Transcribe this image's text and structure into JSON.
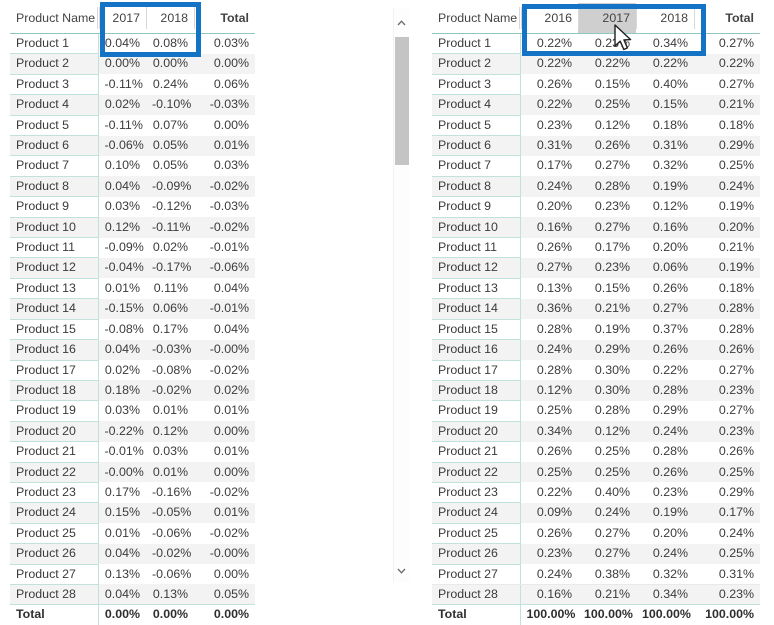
{
  "left_matrix": {
    "name": "percent-difference-matrix",
    "headers": [
      "Product Name",
      "2017",
      "2018",
      "Total"
    ],
    "rows": [
      {
        "label": "Product 1",
        "values": [
          "0.04%",
          "0.08%"
        ],
        "total": "0.03%"
      },
      {
        "label": "Product 2",
        "values": [
          "0.00%",
          "0.00%"
        ],
        "total": "0.00%"
      },
      {
        "label": "Product 3",
        "values": [
          "-0.11%",
          "0.24%"
        ],
        "total": "0.06%"
      },
      {
        "label": "Product 4",
        "values": [
          "0.02%",
          "-0.10%"
        ],
        "total": "-0.03%"
      },
      {
        "label": "Product 5",
        "values": [
          "-0.11%",
          "0.07%"
        ],
        "total": "0.00%"
      },
      {
        "label": "Product 6",
        "values": [
          "-0.06%",
          "0.05%"
        ],
        "total": "0.01%"
      },
      {
        "label": "Product 7",
        "values": [
          "0.10%",
          "0.05%"
        ],
        "total": "0.03%"
      },
      {
        "label": "Product 8",
        "values": [
          "0.04%",
          "-0.09%"
        ],
        "total": "-0.02%"
      },
      {
        "label": "Product 9",
        "values": [
          "0.03%",
          "-0.12%"
        ],
        "total": "-0.03%"
      },
      {
        "label": "Product 10",
        "values": [
          "0.12%",
          "-0.11%"
        ],
        "total": "-0.02%"
      },
      {
        "label": "Product 11",
        "values": [
          "-0.09%",
          "0.02%"
        ],
        "total": "-0.01%"
      },
      {
        "label": "Product 12",
        "values": [
          "-0.04%",
          "-0.17%"
        ],
        "total": "-0.06%"
      },
      {
        "label": "Product 13",
        "values": [
          "0.01%",
          "0.11%"
        ],
        "total": "0.04%"
      },
      {
        "label": "Product 14",
        "values": [
          "-0.15%",
          "0.06%"
        ],
        "total": "-0.01%"
      },
      {
        "label": "Product 15",
        "values": [
          "-0.08%",
          "0.17%"
        ],
        "total": "0.04%"
      },
      {
        "label": "Product 16",
        "values": [
          "0.04%",
          "-0.03%"
        ],
        "total": "-0.00%"
      },
      {
        "label": "Product 17",
        "values": [
          "0.02%",
          "-0.08%"
        ],
        "total": "-0.02%"
      },
      {
        "label": "Product 18",
        "values": [
          "0.18%",
          "-0.02%"
        ],
        "total": "0.02%"
      },
      {
        "label": "Product 19",
        "values": [
          "0.03%",
          "0.01%"
        ],
        "total": "0.01%"
      },
      {
        "label": "Product 20",
        "values": [
          "-0.22%",
          "0.12%"
        ],
        "total": "0.00%"
      },
      {
        "label": "Product 21",
        "values": [
          "-0.01%",
          "0.03%"
        ],
        "total": "0.01%"
      },
      {
        "label": "Product 22",
        "values": [
          "-0.00%",
          "0.01%"
        ],
        "total": "0.00%"
      },
      {
        "label": "Product 23",
        "values": [
          "0.17%",
          "-0.16%"
        ],
        "total": "-0.02%"
      },
      {
        "label": "Product 24",
        "values": [
          "0.15%",
          "-0.05%"
        ],
        "total": "0.01%"
      },
      {
        "label": "Product 25",
        "values": [
          "0.01%",
          "-0.06%"
        ],
        "total": "-0.02%"
      },
      {
        "label": "Product 26",
        "values": [
          "0.04%",
          "-0.02%"
        ],
        "total": "-0.00%"
      },
      {
        "label": "Product 27",
        "values": [
          "0.13%",
          "-0.06%"
        ],
        "total": "0.00%"
      },
      {
        "label": "Product 28",
        "values": [
          "0.04%",
          "0.13%"
        ],
        "total": "0.05%"
      }
    ],
    "total_row": {
      "label": "Total",
      "values": [
        "0.00%",
        "0.00%"
      ],
      "total": "0.00%"
    }
  },
  "right_matrix": {
    "name": "percent-of-column-total-matrix",
    "headers": [
      "Product Name",
      "2016",
      "2017",
      "2018",
      "Total"
    ],
    "highlighted_header": "2017",
    "rows": [
      {
        "label": "Product 1",
        "values": [
          "0.22%",
          "0.23%",
          "0.34%"
        ],
        "total": "0.27%"
      },
      {
        "label": "Product 2",
        "values": [
          "0.22%",
          "0.22%",
          "0.22%"
        ],
        "total": "0.22%"
      },
      {
        "label": "Product 3",
        "values": [
          "0.26%",
          "0.15%",
          "0.40%"
        ],
        "total": "0.27%"
      },
      {
        "label": "Product 4",
        "values": [
          "0.22%",
          "0.25%",
          "0.15%"
        ],
        "total": "0.21%"
      },
      {
        "label": "Product 5",
        "values": [
          "0.23%",
          "0.12%",
          "0.18%"
        ],
        "total": "0.18%"
      },
      {
        "label": "Product 6",
        "values": [
          "0.31%",
          "0.26%",
          "0.31%"
        ],
        "total": "0.29%"
      },
      {
        "label": "Product 7",
        "values": [
          "0.17%",
          "0.27%",
          "0.32%"
        ],
        "total": "0.25%"
      },
      {
        "label": "Product 8",
        "values": [
          "0.24%",
          "0.28%",
          "0.19%"
        ],
        "total": "0.24%"
      },
      {
        "label": "Product 9",
        "values": [
          "0.20%",
          "0.23%",
          "0.12%"
        ],
        "total": "0.19%"
      },
      {
        "label": "Product 10",
        "values": [
          "0.16%",
          "0.27%",
          "0.16%"
        ],
        "total": "0.20%"
      },
      {
        "label": "Product 11",
        "values": [
          "0.26%",
          "0.17%",
          "0.20%"
        ],
        "total": "0.21%"
      },
      {
        "label": "Product 12",
        "values": [
          "0.27%",
          "0.23%",
          "0.06%"
        ],
        "total": "0.19%"
      },
      {
        "label": "Product 13",
        "values": [
          "0.13%",
          "0.15%",
          "0.26%"
        ],
        "total": "0.18%"
      },
      {
        "label": "Product 14",
        "values": [
          "0.36%",
          "0.21%",
          "0.27%"
        ],
        "total": "0.28%"
      },
      {
        "label": "Product 15",
        "values": [
          "0.28%",
          "0.19%",
          "0.37%"
        ],
        "total": "0.28%"
      },
      {
        "label": "Product 16",
        "values": [
          "0.24%",
          "0.29%",
          "0.26%"
        ],
        "total": "0.26%"
      },
      {
        "label": "Product 17",
        "values": [
          "0.28%",
          "0.30%",
          "0.22%"
        ],
        "total": "0.27%"
      },
      {
        "label": "Product 18",
        "values": [
          "0.12%",
          "0.30%",
          "0.28%"
        ],
        "total": "0.23%"
      },
      {
        "label": "Product 19",
        "values": [
          "0.25%",
          "0.28%",
          "0.29%"
        ],
        "total": "0.27%"
      },
      {
        "label": "Product 20",
        "values": [
          "0.34%",
          "0.12%",
          "0.24%"
        ],
        "total": "0.23%"
      },
      {
        "label": "Product 21",
        "values": [
          "0.26%",
          "0.25%",
          "0.28%"
        ],
        "total": "0.26%"
      },
      {
        "label": "Product 22",
        "values": [
          "0.25%",
          "0.25%",
          "0.26%"
        ],
        "total": "0.25%"
      },
      {
        "label": "Product 23",
        "values": [
          "0.22%",
          "0.40%",
          "0.23%"
        ],
        "total": "0.29%"
      },
      {
        "label": "Product 24",
        "values": [
          "0.09%",
          "0.24%",
          "0.19%"
        ],
        "total": "0.17%"
      },
      {
        "label": "Product 25",
        "values": [
          "0.26%",
          "0.27%",
          "0.20%"
        ],
        "total": "0.24%"
      },
      {
        "label": "Product 26",
        "values": [
          "0.23%",
          "0.27%",
          "0.24%"
        ],
        "total": "0.25%"
      },
      {
        "label": "Product 27",
        "values": [
          "0.24%",
          "0.38%",
          "0.32%"
        ],
        "total": "0.31%"
      },
      {
        "label": "Product 28",
        "values": [
          "0.16%",
          "0.21%",
          "0.34%"
        ],
        "total": "0.23%"
      }
    ],
    "total_row": {
      "label": "Total",
      "values": [
        "100.00%",
        "100.00%",
        "100.00%"
      ],
      "total": "100.00%"
    }
  },
  "scrollbar": {
    "up_icon": "chevron-up-icon",
    "down_icon": "chevron-down-icon"
  },
  "annotations": [
    {
      "name": "left-highlight-box",
      "color": "#1573c6"
    },
    {
      "name": "right-highlight-box",
      "color": "#1573c6"
    }
  ],
  "cursor": {
    "icon": "mouse-pointer-icon"
  },
  "colors": {
    "annotation_blue": "#1573c6",
    "row_separator": "#bfe3dc",
    "alt_row": "#f3f3f3",
    "header_underline": "#8fc7bd",
    "hover_header": "#cfcfcf",
    "scroll_thumb": "#c4c4c4",
    "text": "#3b3b3b"
  }
}
